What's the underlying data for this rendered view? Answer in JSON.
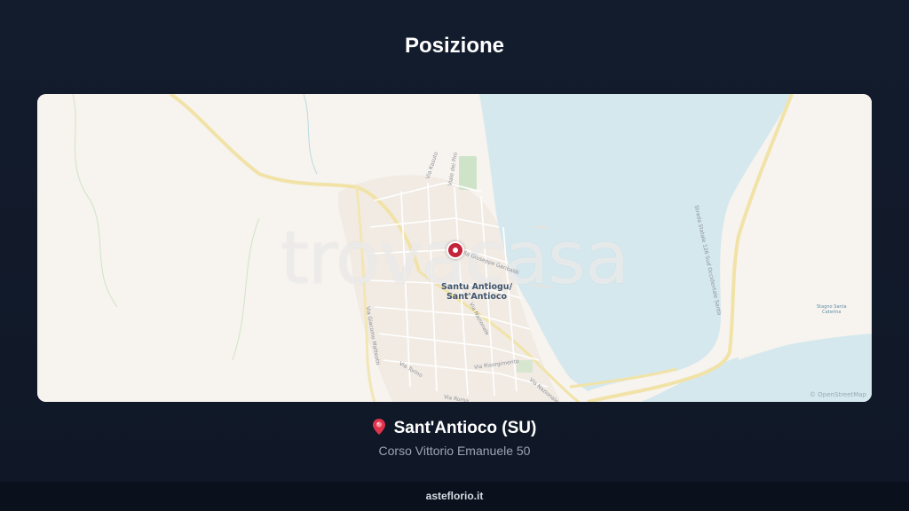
{
  "page": {
    "title": "Posizione"
  },
  "map": {
    "watermark": "trovacasa",
    "city_label_line1": "Santu Antiogu/",
    "city_label_line2": "Sant'Antioco",
    "streets": [
      "Via Kasuto",
      "Viale dei Pini",
      "Via Giuseppe Garibaldi",
      "Via Giacomo Matteotti",
      "Via Nazionale",
      "Via Torino",
      "Via Risorgimento",
      "Via Roma",
      "Strada Statale 126 Sud Occidentale Sarda",
      "Via Nazionale"
    ],
    "lagoon_line1": "Stagno Santa",
    "lagoon_line2": "Caterina",
    "attribution": "© OpenStreetMap",
    "colors": {
      "land": "#f7f3ee",
      "water": "#d5e8ee",
      "road": "#f1e3a8",
      "marker": "#c4243a"
    }
  },
  "location": {
    "icon": "pin-icon",
    "name": "Sant'Antioco (SU)",
    "address": "Corso Vittorio Emanuele 50"
  },
  "footer": {
    "brand": "asteflorio.it"
  }
}
